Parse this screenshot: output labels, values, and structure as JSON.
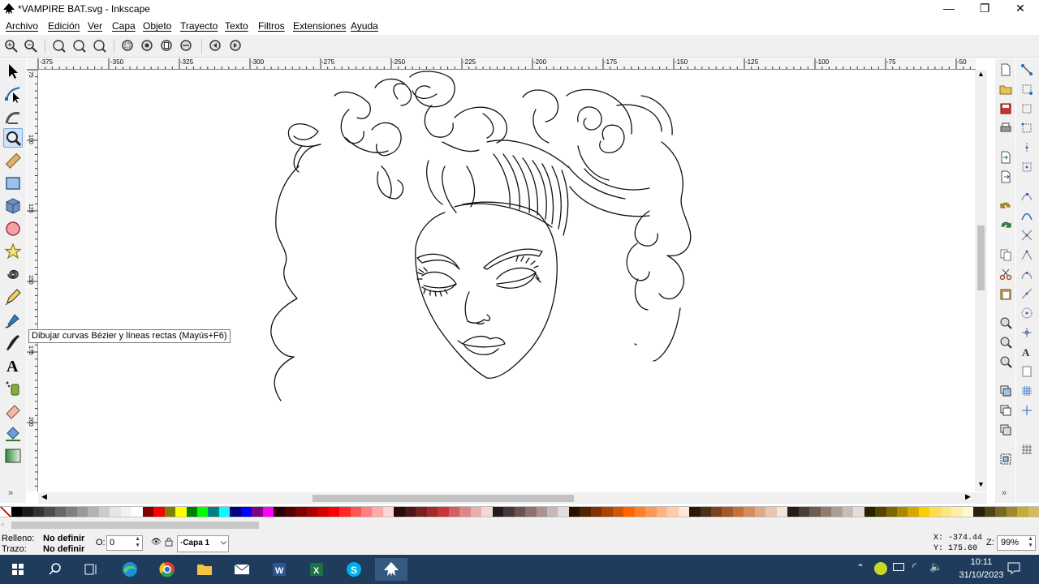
{
  "window": {
    "title": "*VAMPIRE BAT.svg - Inkscape",
    "minimize": "—",
    "restore": "❐",
    "close": "✕"
  },
  "menu": [
    "Archivo",
    "Edición",
    "Ver",
    "Capa",
    "Objeto",
    "Trayecto",
    "Texto",
    "Filtros",
    "Extensiones",
    "Ayuda"
  ],
  "ruler": {
    "h_labels": [
      "-375",
      "-350",
      "-325",
      "-300",
      "-275",
      "-250",
      "-225",
      "-200",
      "-175",
      "-150",
      "-125",
      "-100",
      "-75",
      "-50"
    ],
    "v_labels": [
      "75",
      "100",
      "125",
      "150",
      "175",
      "200"
    ]
  },
  "tooltip": "Dibujar curvas Bézier y líneas rectas (Mayús+F6)",
  "status": {
    "fill_label": "Relleno:",
    "fill_value": "No definir",
    "stroke_label": "Trazo:",
    "stroke_value": "No definir",
    "opacity_label": "O:",
    "opacity_value": "0",
    "layer": "·Capa 1",
    "x_coord": "X: -374.44",
    "y_coord": "Y:  175.60",
    "zoom_label": "Z:",
    "zoom_value": "99%"
  },
  "clock": {
    "time": "10:11",
    "date": "31/10/2023"
  },
  "palette": [
    "#000000",
    "#1a1a1a",
    "#333333",
    "#4d4d4d",
    "#666666",
    "#808080",
    "#999999",
    "#b3b3b3",
    "#cccccc",
    "#e6e6e6",
    "#f2f2f2",
    "#ffffff",
    "#800000",
    "#ff0000",
    "#808000",
    "#ffff00",
    "#008000",
    "#00ff00",
    "#008080",
    "#00ffff",
    "#000080",
    "#0000ff",
    "#800080",
    "#ff00ff",
    "#2b0000",
    "#550000",
    "#800000",
    "#aa0000",
    "#d40000",
    "#ff0000",
    "#ff2a2a",
    "#ff5555",
    "#ff8080",
    "#ffaaaa",
    "#ffd5d5",
    "#280b0b",
    "#501616",
    "#782121",
    "#a02c2c",
    "#c83737",
    "#d35f5f",
    "#de8787",
    "#e9afaf",
    "#f4d7d7",
    "#241c1c",
    "#483737",
    "#6c5353",
    "#916f6f",
    "#ac9393",
    "#c8b7b7",
    "#e3dbdb",
    "#2b1100",
    "#552200",
    "#803300",
    "#aa4400",
    "#d45500",
    "#ff6600",
    "#ff7f2a",
    "#ff9955",
    "#ffb380",
    "#ffccaa",
    "#ffe6d5",
    "#28170b",
    "#502d16",
    "#784421",
    "#a05a2c",
    "#c87137",
    "#d38d5f",
    "#deaa87",
    "#e9c6af",
    "#f4e3d7",
    "#241f1c",
    "#483e37",
    "#6c5d53",
    "#917c6f",
    "#ac9d93",
    "#c8beb7",
    "#e3dedb",
    "#2b2200",
    "#554400",
    "#806600",
    "#aa8800",
    "#d4aa00",
    "#ffcc00",
    "#ffdd55",
    "#ffe680",
    "#ffeeaa",
    "#fff6d5",
    "#28220b",
    "#504416",
    "#786721",
    "#a0892c",
    "#c8ab37",
    "#d3bc5f"
  ]
}
